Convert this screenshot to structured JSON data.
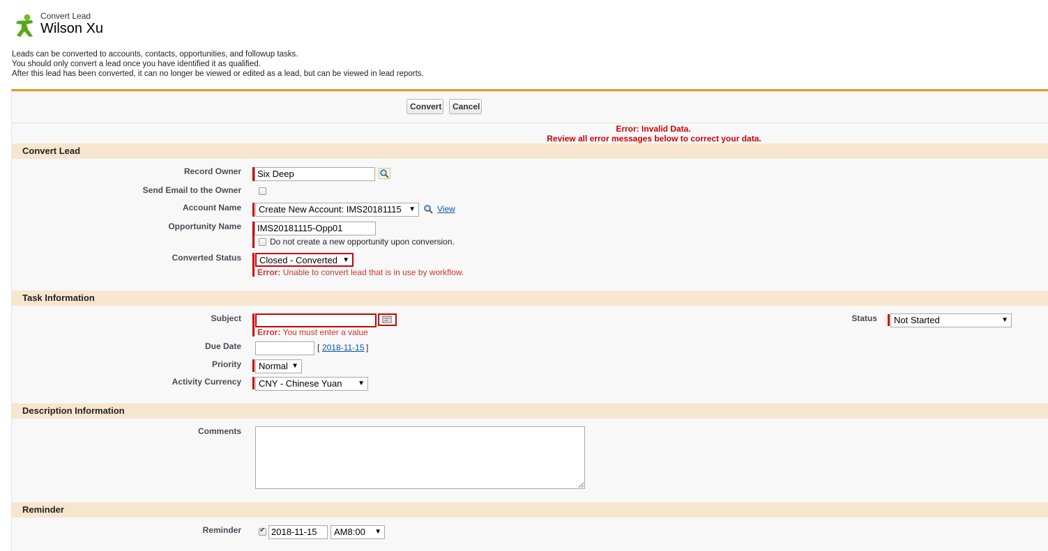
{
  "header": {
    "breadcrumb": "Convert Lead",
    "title": "Wilson Xu"
  },
  "intro": [
    "Leads can be converted to accounts, contacts, opportunities, and followup tasks.",
    "You should only convert a lead once you have identified it as qualified.",
    "After this lead has been converted, it can no longer be viewed or edited as a lead, but can be viewed in lead reports."
  ],
  "toolbar": {
    "convert_label": "Convert",
    "cancel_label": "Cancel"
  },
  "page_error": {
    "line1": "Error: Invalid Data.",
    "line2": "Review all error messages below to correct your data."
  },
  "sections": {
    "convert_lead": "Convert Lead",
    "task_information": "Task Information",
    "description_information": "Description Information",
    "reminder": "Reminder"
  },
  "convert_lead": {
    "record_owner_label": "Record Owner",
    "record_owner_value": "Six Deep",
    "send_email_label": "Send Email to the Owner",
    "account_name_label": "Account Name",
    "account_name_value": "Create New Account: IMS20181115",
    "view_link": "View",
    "opportunity_name_label": "Opportunity Name",
    "opportunity_name_value": "IMS20181115-Opp01",
    "no_opportunity_label": "Do not create a new opportunity upon conversion.",
    "converted_status_label": "Converted Status",
    "converted_status_value": "Closed - Converted",
    "converted_status_error_prefix": "Error:",
    "converted_status_error": "Unable to convert lead that is in use by workflow."
  },
  "task": {
    "subject_label": "Subject",
    "subject_value": "",
    "subject_error_prefix": "Error:",
    "subject_error": "You must enter a value",
    "status_label": "Status",
    "status_value": "Not Started",
    "due_date_label": "Due Date",
    "due_date_value": "",
    "today_link": "2018-11-15",
    "bracket_open": "[",
    "bracket_close": "]",
    "priority_label": "Priority",
    "priority_value": "Normal",
    "currency_label": "Activity Currency",
    "currency_value": "CNY - Chinese Yuan"
  },
  "description": {
    "comments_label": "Comments",
    "comments_value": ""
  },
  "reminder": {
    "reminder_label": "Reminder",
    "date_value": "2018-11-15",
    "time_value": "AM8:00"
  },
  "icons": {
    "logo": "lead-person-icon",
    "lookup": "magnifier-lookup-icon",
    "subject_combo": "combobox-picker-icon"
  },
  "colors": {
    "accent_orange": "#e39321",
    "section_bg": "#f7e6cf",
    "required_red": "#cc0000",
    "link_blue": "#015ba7"
  }
}
